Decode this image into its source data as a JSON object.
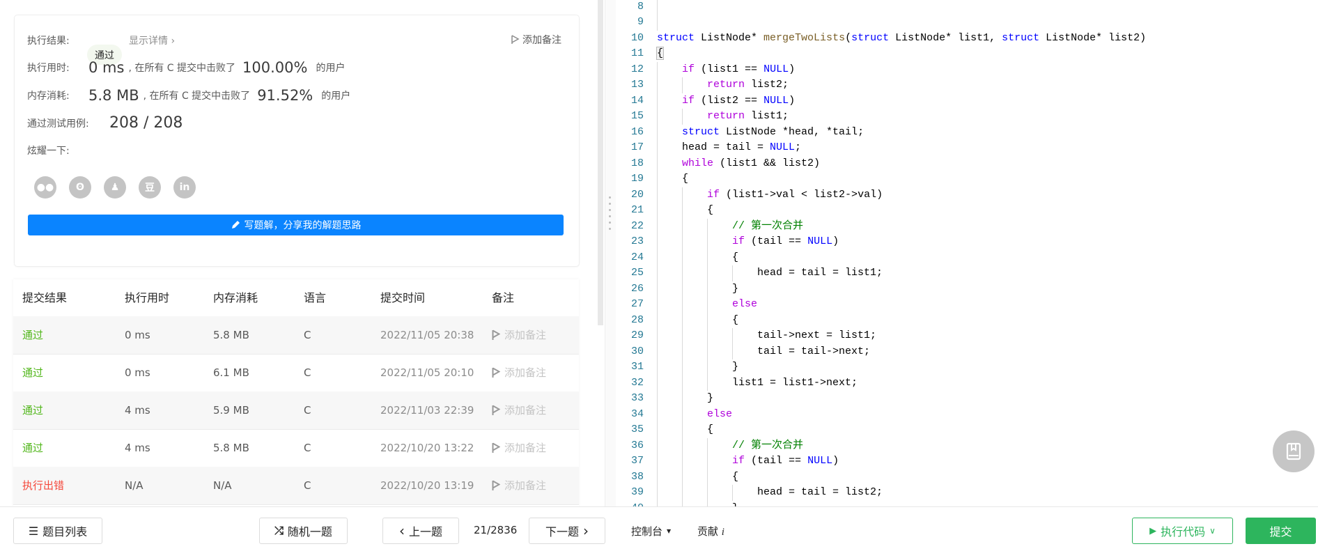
{
  "result_card": {
    "result_label": "执行结果:",
    "result_status": "通过",
    "show_details": "显示详情 ›",
    "add_note": "添加备注",
    "runtime_label": "执行用时:",
    "runtime_value": "0 ms",
    "runtime_mid": ", 在所有 C 提交中击败了",
    "runtime_percent": "100.00%",
    "runtime_suffix": "的用户",
    "memory_label": "内存消耗:",
    "memory_value": "5.8 MB",
    "memory_mid": ", 在所有 C 提交中击败了",
    "memory_percent": "91.52%",
    "memory_suffix": "的用户",
    "tests_label": "通过测试用例:",
    "tests_value": "208 / 208",
    "share_label": "炫耀一下:",
    "share_icons": [
      "wechat-icon",
      "weibo-icon",
      "qq-icon",
      "douban-icon",
      "linkedin-icon"
    ],
    "share_glyphs": [
      "●●",
      "ʘ",
      "♟",
      "豆",
      "in"
    ],
    "write_solution": "写题解，分享我的解题思路"
  },
  "submissions": {
    "headers": [
      "提交结果",
      "执行用时",
      "内存消耗",
      "语言",
      "提交时间",
      "备注"
    ],
    "rows": [
      {
        "status": "通过",
        "status_type": "pass",
        "time": "0 ms",
        "memory": "5.8 MB",
        "lang": "C",
        "submitted": "2022/11/05 20:38",
        "note": "添加备注"
      },
      {
        "status": "通过",
        "status_type": "pass",
        "time": "0 ms",
        "memory": "6.1 MB",
        "lang": "C",
        "submitted": "2022/11/05 20:10",
        "note": "添加备注"
      },
      {
        "status": "通过",
        "status_type": "pass",
        "time": "4 ms",
        "memory": "5.9 MB",
        "lang": "C",
        "submitted": "2022/11/03 22:39",
        "note": "添加备注"
      },
      {
        "status": "通过",
        "status_type": "pass",
        "time": "4 ms",
        "memory": "5.8 MB",
        "lang": "C",
        "submitted": "2022/10/20 13:22",
        "note": "添加备注"
      },
      {
        "status": "执行出错",
        "status_type": "error",
        "time": "N/A",
        "memory": "N/A",
        "lang": "C",
        "submitted": "2022/10/20 13:19",
        "note": "添加备注"
      }
    ]
  },
  "colors": {
    "pass": "#52b71c",
    "error": "#f5483b",
    "primary": "#0a84ff",
    "submit": "#2db55d"
  },
  "editor": {
    "first_line_number": 8,
    "lines": [
      "",
      "",
      "struct ListNode* mergeTwoLists(struct ListNode* list1, struct ListNode* list2)",
      "{",
      "    if (list1 == NULL)",
      "        return list2;",
      "    if (list2 == NULL)",
      "        return list1;",
      "    struct ListNode *head, *tail;",
      "    head = tail = NULL;",
      "    while (list1 && list2)",
      "    {",
      "        if (list1->val < list2->val)",
      "        {",
      "            // 第一次合并",
      "            if (tail == NULL)",
      "            {",
      "                head = tail = list1;",
      "            }",
      "            else",
      "            {",
      "                tail->next = list1;",
      "                tail = tail->next;",
      "            }",
      "            list1 = list1->next;",
      "        }",
      "        else",
      "        {",
      "            // 第一次合并",
      "            if (tail == NULL)",
      "            {",
      "                head = tail = list2;",
      "            }"
    ]
  },
  "bottom": {
    "problem_list": "题目列表",
    "random": "随机一题",
    "prev": "上一题",
    "page": "21/2836",
    "next": "下一题",
    "console": "控制台",
    "contribute": "贡献",
    "contribute_i": "i",
    "run_code": "执行代码",
    "submit": "提交"
  }
}
